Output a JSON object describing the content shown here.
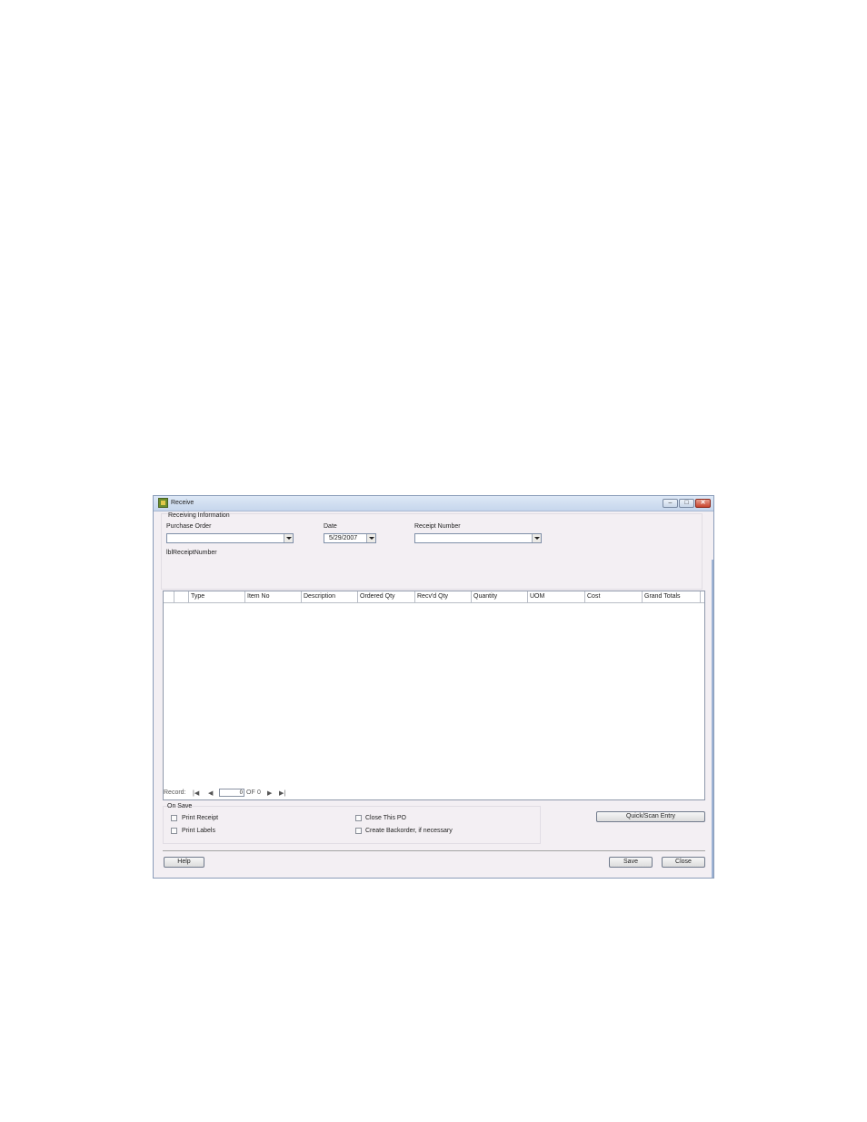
{
  "window": {
    "title": "Receive",
    "controls": {
      "minimize": "–",
      "maximize": "□",
      "close": "✕"
    }
  },
  "receiving_info": {
    "group_title": "Receiving Information",
    "purchase_order_label": "Purchase Order",
    "purchase_order_value": "",
    "date_label": "Date",
    "date_value": "5/29/2007",
    "receipt_number_label": "Receipt Number",
    "receipt_number_value": "",
    "lbl_receipt_number": "lblReceiptNumber"
  },
  "grid": {
    "columns": [
      "",
      "Type",
      "Item No",
      "Description",
      "Ordered Qty",
      "Recv'd Qty",
      "Quantity",
      "UOM",
      "Cost",
      "Grand Totals"
    ],
    "rows": []
  },
  "record_nav": {
    "label": "Record:",
    "first": "|◀",
    "prev": "◀",
    "current": "0",
    "of_label": "OF",
    "total": "0",
    "next": "▶",
    "last": "▶|"
  },
  "on_save": {
    "group_title": "On Save",
    "print_receipt": "Print Receipt",
    "print_labels": "Print Labels",
    "close_po": "Close This PO",
    "create_backorder": "Create Backorder, if necessary"
  },
  "buttons": {
    "quick_scan": "Quick/Scan Entry",
    "help": "Help",
    "save": "Save",
    "close": "Close"
  }
}
